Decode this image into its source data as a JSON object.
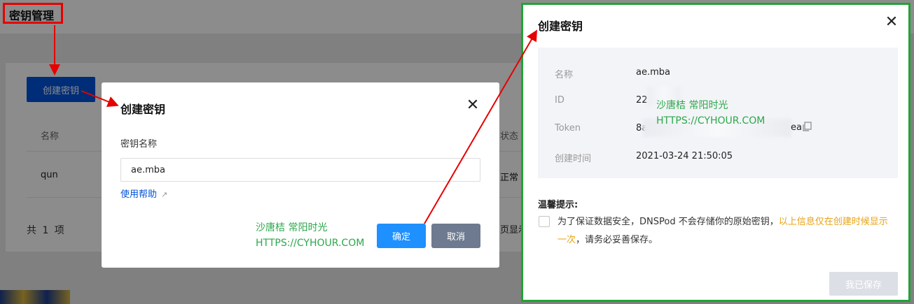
{
  "background": {
    "page_title": "密钥管理",
    "create_button": "创建密钥",
    "table": {
      "headers": [
        "名称",
        "状态"
      ],
      "rows": [
        {
          "name": "qun",
          "status": "正常"
        }
      ]
    },
    "total": "共 1 项",
    "pager_text": "页显示"
  },
  "dialog": {
    "title": "创建密钥",
    "field_label": "密钥名称",
    "field_value": "ae.mba",
    "help_link": "使用帮助",
    "confirm": "确定",
    "cancel": "取消"
  },
  "watermark": {
    "line1": "沙唐桔 常阳时光",
    "line2": "HTTPS://CYHOUR.COM"
  },
  "result_panel": {
    "title": "创建密钥",
    "fields": [
      {
        "key": "名称",
        "value": "ae.mba"
      },
      {
        "key": "ID",
        "value": "22"
      },
      {
        "key": "Token",
        "value": "8a",
        "value_end": "ea"
      },
      {
        "key": "创建时间",
        "value": "2021-03-24 21:50:05"
      }
    ],
    "tips_title": "温馨提示:",
    "tips_text": "为了保证数据安全，DNSPod 不会存储你的原始密钥，",
    "tips_warning": "以上信息仅在创建时候显示一次",
    "tips_tail": "，请务必妥善保存。",
    "saved_button": "我已保存"
  },
  "colors": {
    "primary": "#0052d9",
    "confirm": "#1e90ff",
    "cancel": "#6d7a8f",
    "highlight_red": "#e60000",
    "highlight_green": "#21a335",
    "watermark": "#2ba84a",
    "warning": "#e8a317"
  },
  "icons": [
    "close-icon",
    "external-link-icon",
    "copy-icon",
    "arrow-icon"
  ]
}
